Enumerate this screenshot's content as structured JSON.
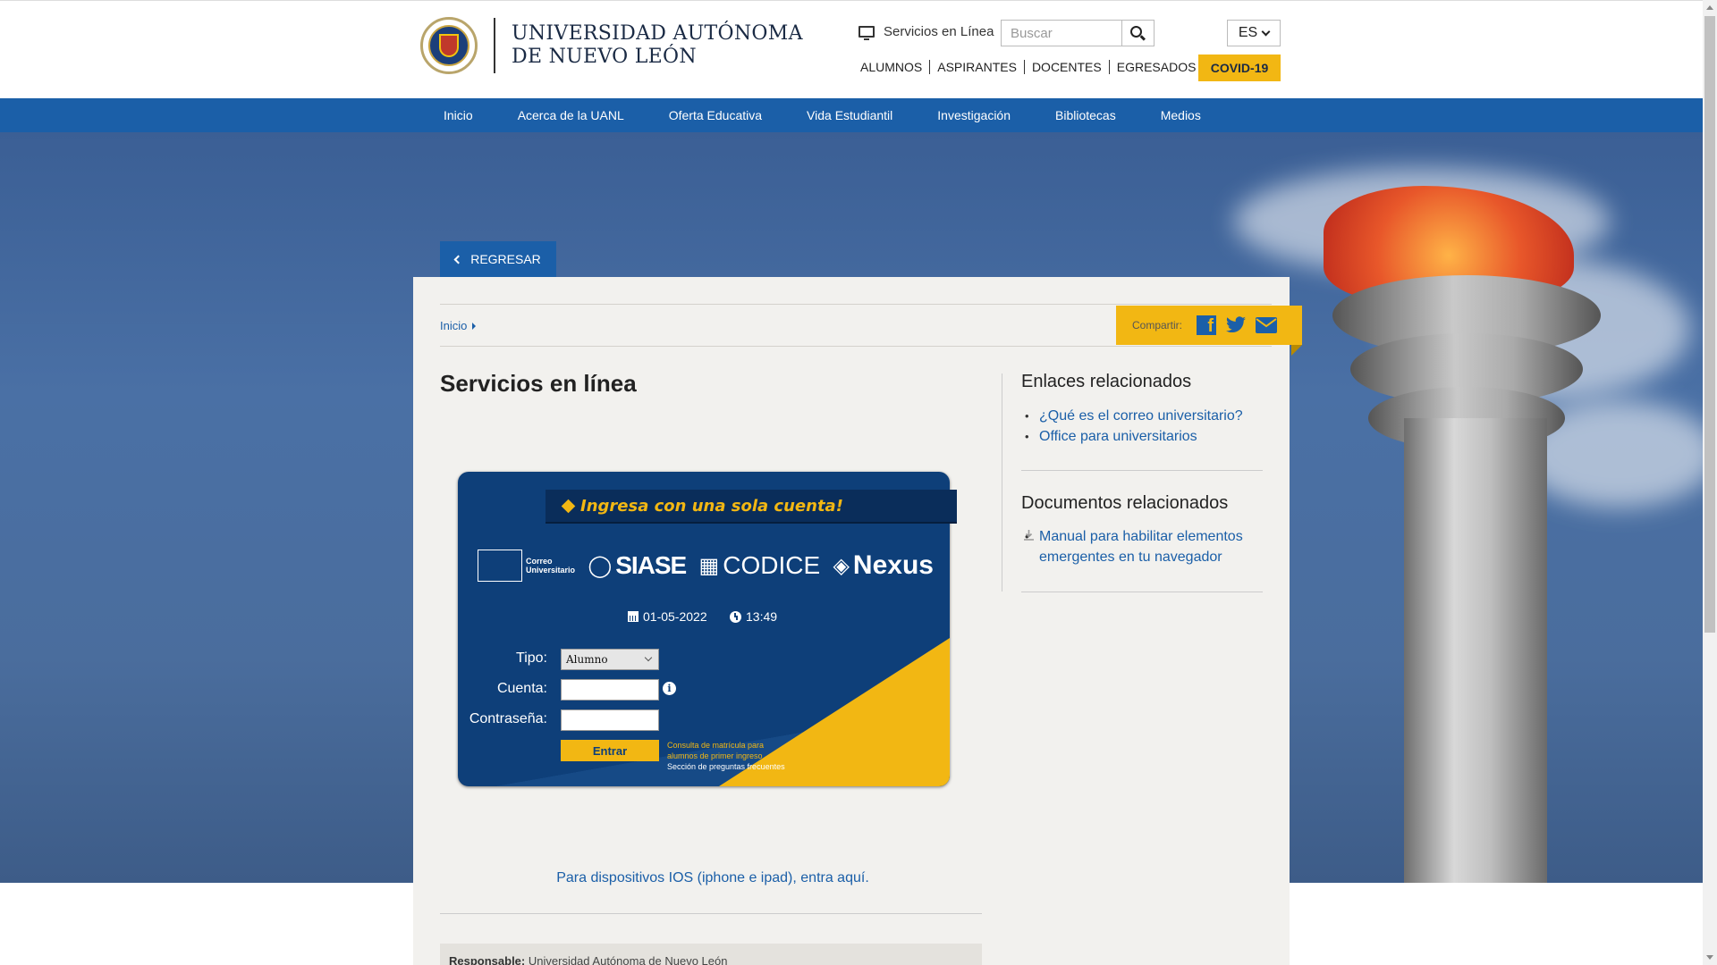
{
  "header": {
    "university_name_line1": "UNIVERSIDAD AUTÓNOMA",
    "university_name_line2": "DE NUEVO LEÓN",
    "servicios_link": "Servicios en Línea",
    "search_placeholder": "Buscar",
    "language": "ES",
    "audience_links": [
      "ALUMNOS",
      "ASPIRANTES",
      "DOCENTES",
      "EGRESADOS"
    ],
    "covid_button": "COVID-19"
  },
  "nav": {
    "items": [
      "Inicio",
      "Acerca de la UANL",
      "Oferta Educativa",
      "Vida Estudiantil",
      "Investigación",
      "Bibliotecas",
      "Medios"
    ]
  },
  "page": {
    "back_button": "REGRESAR",
    "breadcrumb": "Inicio",
    "share_label": "Compartir:",
    "title": "Servicios en línea",
    "ios_link": "Para dispositivos IOS (iphone e ipad), entra aquí.",
    "responsable_label": "Responsable:",
    "responsable_value": "Universidad Autónoma de Nuevo León"
  },
  "sidebar": {
    "enlaces_heading": "Enlaces relacionados",
    "enlaces": [
      "¿Qué es el correo universitario?",
      "Office para universitarios"
    ],
    "documentos_heading": "Documentos relacionados",
    "documentos": [
      "Manual para habilitar elementos emergentes en tu navegador"
    ]
  },
  "login_card": {
    "ribbon_text": "Ingresa con una sola cuenta!",
    "brands": {
      "correo_line1": "Correo",
      "correo_line2": "Universitario",
      "siase": "SIASE",
      "codice": "CODICE",
      "nexus": "Nexus"
    },
    "date": "01-05-2022",
    "time": "13:49",
    "tipo_label": "Tipo:",
    "tipo_value": "Alumno",
    "cuenta_label": "Cuenta:",
    "contrasena_label": "Contraseña:",
    "entrar_button": "Entrar",
    "consulta_line1": "Consulta de matrícula para",
    "consulta_line2": "alumnos de primer ingreso",
    "faq_link": "Sección de preguntas frecuentes"
  },
  "colors": {
    "brand_blue": "#1b5fa8",
    "card_navy": "#0e3f79",
    "accent_gold": "#f2b713"
  }
}
